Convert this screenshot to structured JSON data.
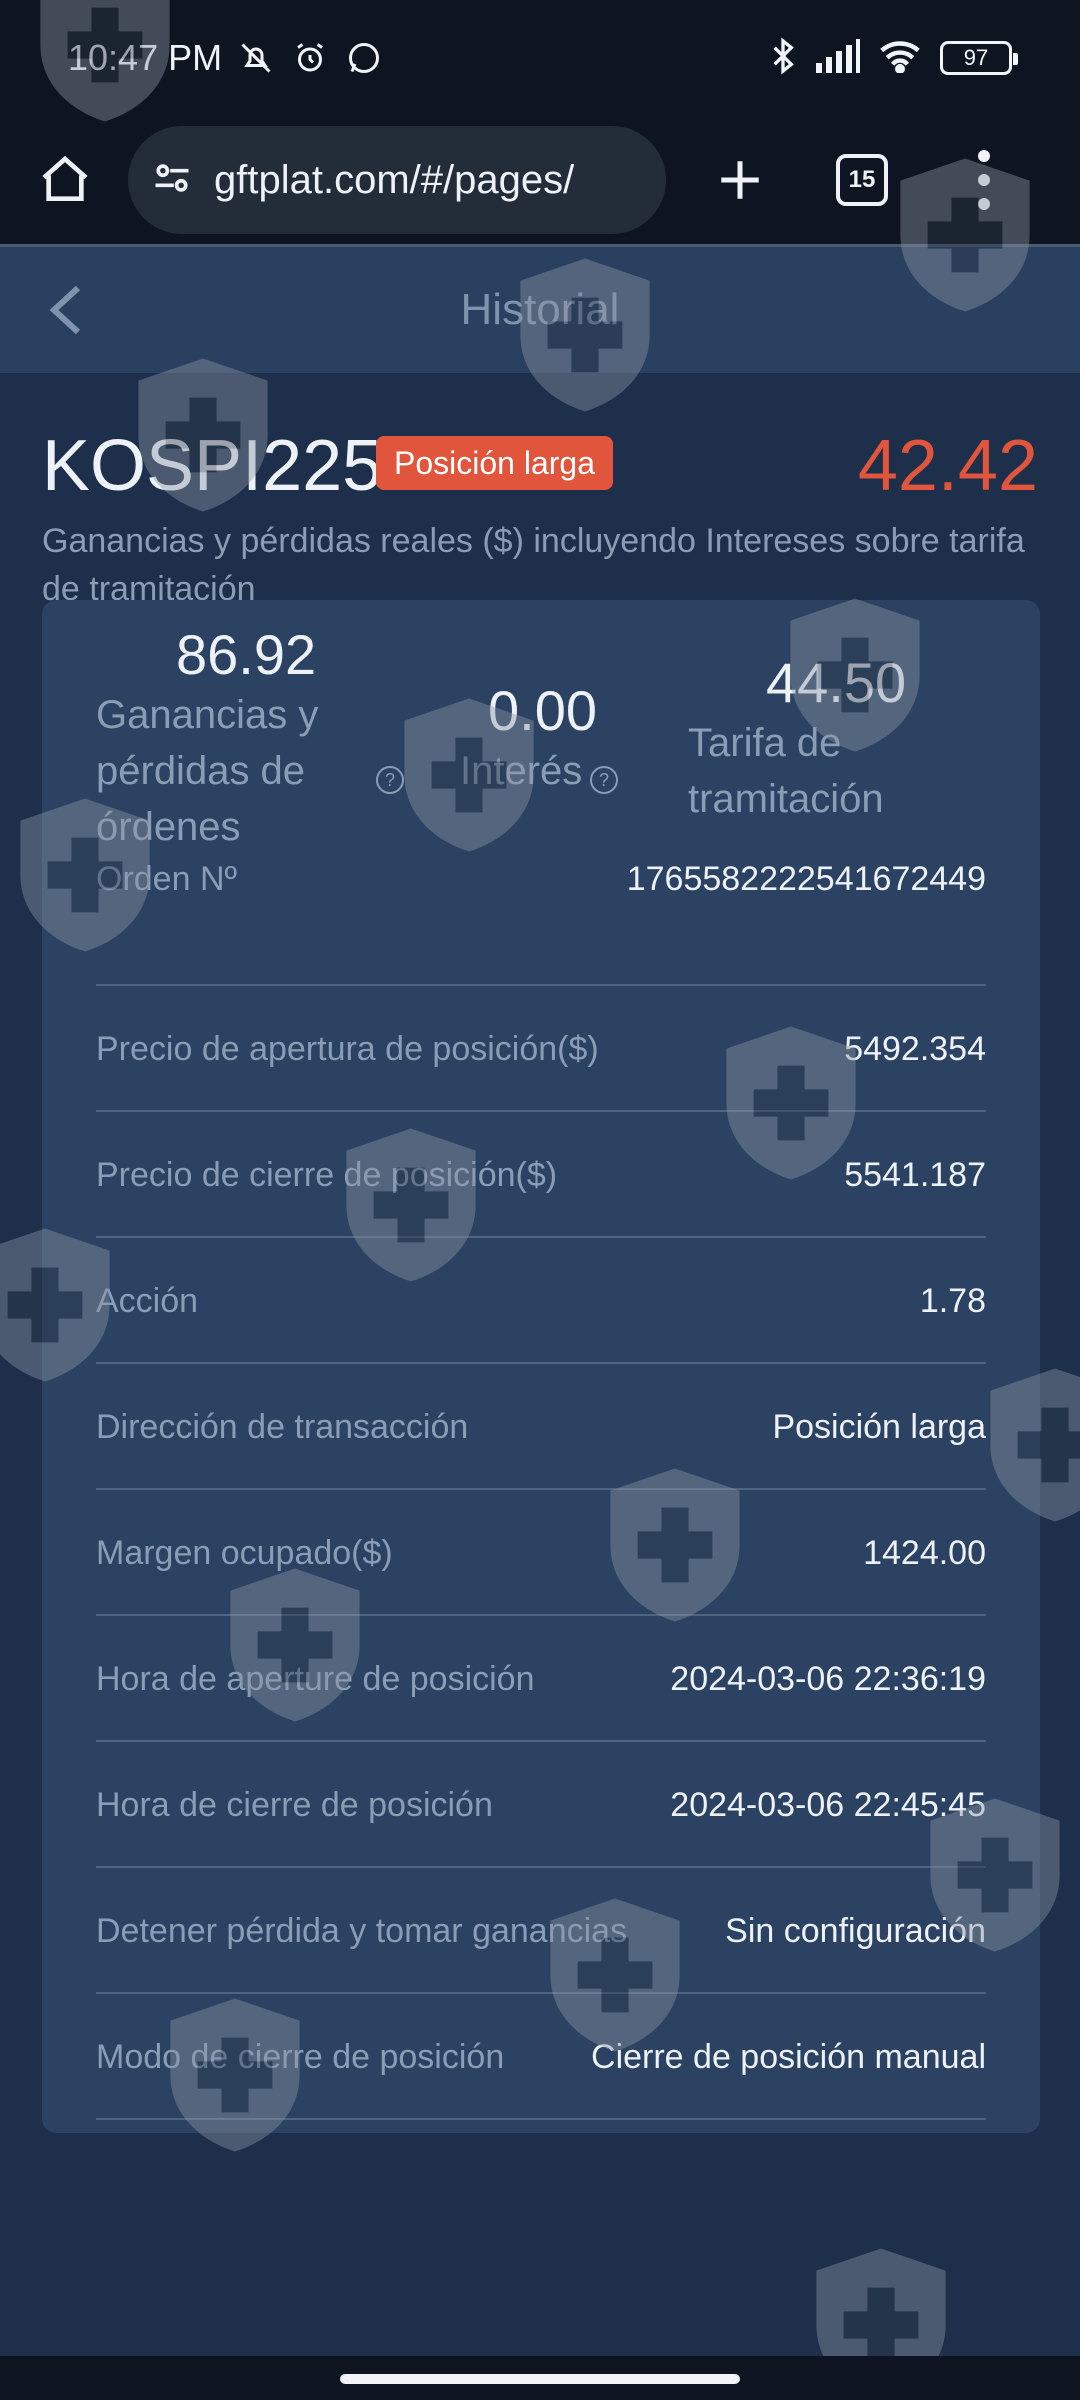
{
  "status_bar": {
    "time": "10:47 PM",
    "battery": "97"
  },
  "browser": {
    "url": "gftplat.com/#/pages/",
    "tab_count": "15"
  },
  "header": {
    "title": "Historial"
  },
  "summary": {
    "product": "KOSPI225",
    "badge": "Posición larga",
    "pnl": "42.42",
    "description": "Ganancias y pérdidas reales ($) incluyendo Intereses sobre tarifa de tramitación"
  },
  "stats": [
    {
      "value": "86.92",
      "label": "Ganancias y pérdidas de órdenes"
    },
    {
      "value": "0.00",
      "label": "Interés"
    },
    {
      "value": "44.50",
      "label": "Tarifa de tramitación"
    }
  ],
  "details": [
    {
      "label": "Orden Nº",
      "value": "1765582222541672449"
    },
    {
      "label": "Precio de apertura de posición($)",
      "value": "5492.354"
    },
    {
      "label": "Precio de cierre de posición($)",
      "value": "5541.187"
    },
    {
      "label": "Acción",
      "value": "1.78"
    },
    {
      "label": "Dirección de transacción",
      "value": "Posición larga"
    },
    {
      "label": "Margen ocupado($)",
      "value": "1424.00"
    },
    {
      "label": "Hora de aperture de posición",
      "value": "2024-03-06 22:36:19"
    },
    {
      "label": "Hora de cierre de posición",
      "value": "2024-03-06 22:45:45"
    },
    {
      "label": "Detener pérdida y tomar ganancias",
      "value": "Sin configuración"
    },
    {
      "label": "Modo de cierre de posición",
      "value": "Cierre de posición manual"
    }
  ],
  "colors": {
    "accent_red": "#e0553c",
    "background": "#1d2f4b",
    "card": "#2b4262"
  },
  "icons": [
    "mute-icon",
    "alarm-icon",
    "whatsapp-icon",
    "bluetooth-icon",
    "signal-icon",
    "wifi-icon",
    "home-icon",
    "site-settings-icon",
    "plus-icon",
    "menu-icon",
    "back-icon",
    "help-icon",
    "watermark-shield-icon"
  ]
}
